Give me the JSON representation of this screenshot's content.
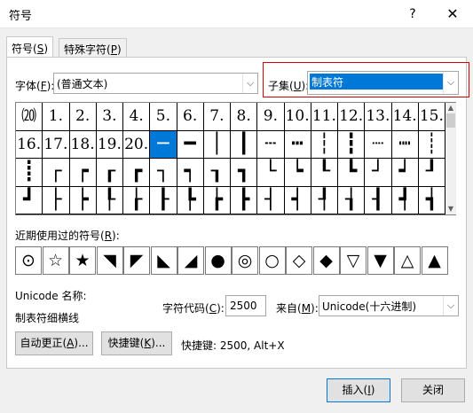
{
  "dialog": {
    "title": "符号",
    "help_glyph": "?",
    "close_glyph": "✕"
  },
  "tabs": [
    {
      "label": "符号(",
      "hotkey": "S",
      "suffix": ")"
    },
    {
      "label": "特殊字符(",
      "hotkey": "P",
      "suffix": ")"
    }
  ],
  "font": {
    "label": "字体(",
    "hotkey": "F",
    "suffix": "):",
    "value": "(普通文本)"
  },
  "subset": {
    "label": "子集(",
    "hotkey": "U",
    "suffix": "):",
    "value": "制表符"
  },
  "symbol_grid": {
    "rows": [
      [
        "⒇",
        "1.",
        "2.",
        "3.",
        "4.",
        "5.",
        "6.",
        "7.",
        "8.",
        "9.",
        "10.",
        "11.",
        "12.",
        "13.",
        "14.",
        "15."
      ],
      [
        "16.",
        "17.",
        "18.",
        "19.",
        "20.",
        "─",
        "━",
        "│",
        "┃",
        "┄",
        "┅",
        "┆",
        "┇",
        "┈",
        "┉",
        "┊"
      ],
      [
        "┋",
        "┌",
        "┍",
        "┎",
        "┏",
        "┐",
        "┑",
        "┒",
        "┓",
        "└",
        "┕",
        "┖",
        "┗",
        "┘",
        "┙",
        "┚"
      ],
      [
        "┛",
        "├",
        "┝",
        "┞",
        "┟",
        "┠",
        "┡",
        "┢",
        "┣",
        "┤",
        "┥",
        "┦",
        "┧",
        "┨",
        "┩",
        "┪"
      ]
    ],
    "selected": "─"
  },
  "recent": {
    "label": "近期使用过的符号(",
    "hotkey": "R",
    "suffix": "):",
    "symbols": [
      "⊙",
      "☆",
      "★",
      "◥",
      "◤",
      "◣",
      "◢",
      "●",
      "◎",
      "○",
      "◇",
      "◆",
      "▽",
      "▼",
      "△",
      "▲"
    ]
  },
  "unicode_name_label": "Unicode 名称:",
  "unicode_name_value": "制表符细横线",
  "char_code": {
    "label": "字符代码(",
    "hotkey": "C",
    "suffix": "):",
    "value": "2500"
  },
  "from": {
    "label": "来自(",
    "hotkey": "M",
    "suffix": "):",
    "value": "Unicode(十六进制)"
  },
  "buttons": {
    "autocorrect": {
      "label": "自动更正(",
      "hotkey": "A",
      "suffix": ")..."
    },
    "shortcut": {
      "label": "快捷键(",
      "hotkey": "K",
      "suffix": ")..."
    },
    "insert": {
      "label": "插入(",
      "hotkey": "I",
      "suffix": ")"
    },
    "close": {
      "label": "关闭"
    }
  },
  "shortcut_info": "快捷键: 2500, Alt+X"
}
